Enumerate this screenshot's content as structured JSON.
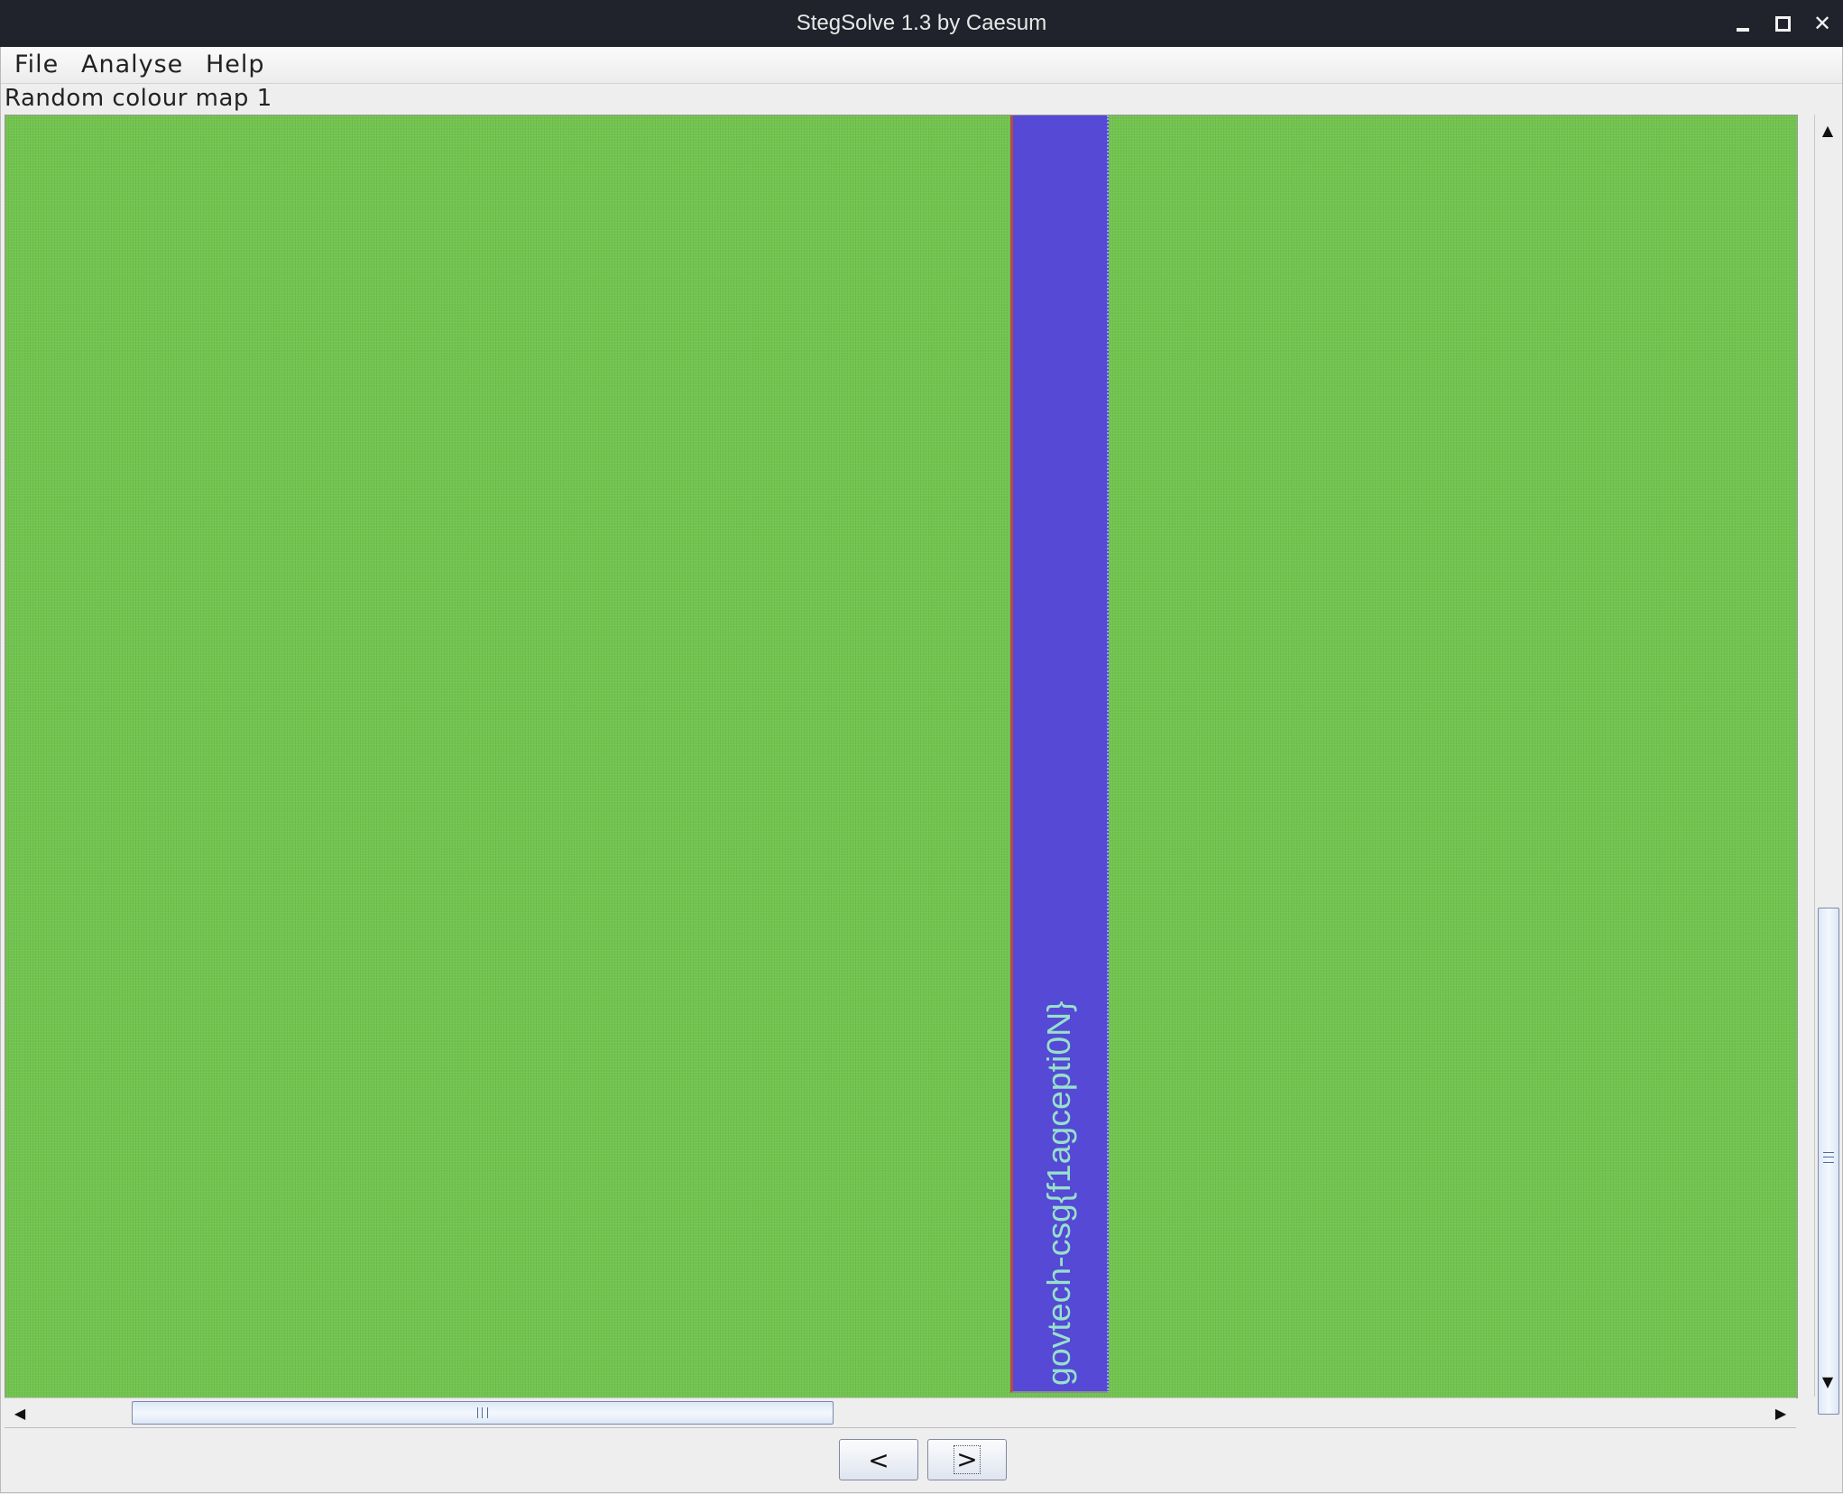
{
  "window": {
    "title": "StegSolve 1.3 by Caesum",
    "controls": {
      "minimize": "minimize",
      "maximize": "maximize",
      "close": "close"
    }
  },
  "menubar": {
    "items": [
      "File",
      "Analyse",
      "Help"
    ]
  },
  "view": {
    "mode_label": "Random colour map 1",
    "hidden_text": "govtech-csg{f1agcepti0N}"
  },
  "navigation": {
    "prev_label": "<",
    "next_label": ">"
  },
  "scrollbars": {
    "vertical": {
      "position_fraction": 0.63
    },
    "horizontal": {
      "position_fraction": 0.09
    }
  },
  "colors": {
    "background_green": "#72c44f",
    "band_blue": "#5549d6",
    "text_cyan": "#97e1ca",
    "titlebar": "#20232b"
  }
}
